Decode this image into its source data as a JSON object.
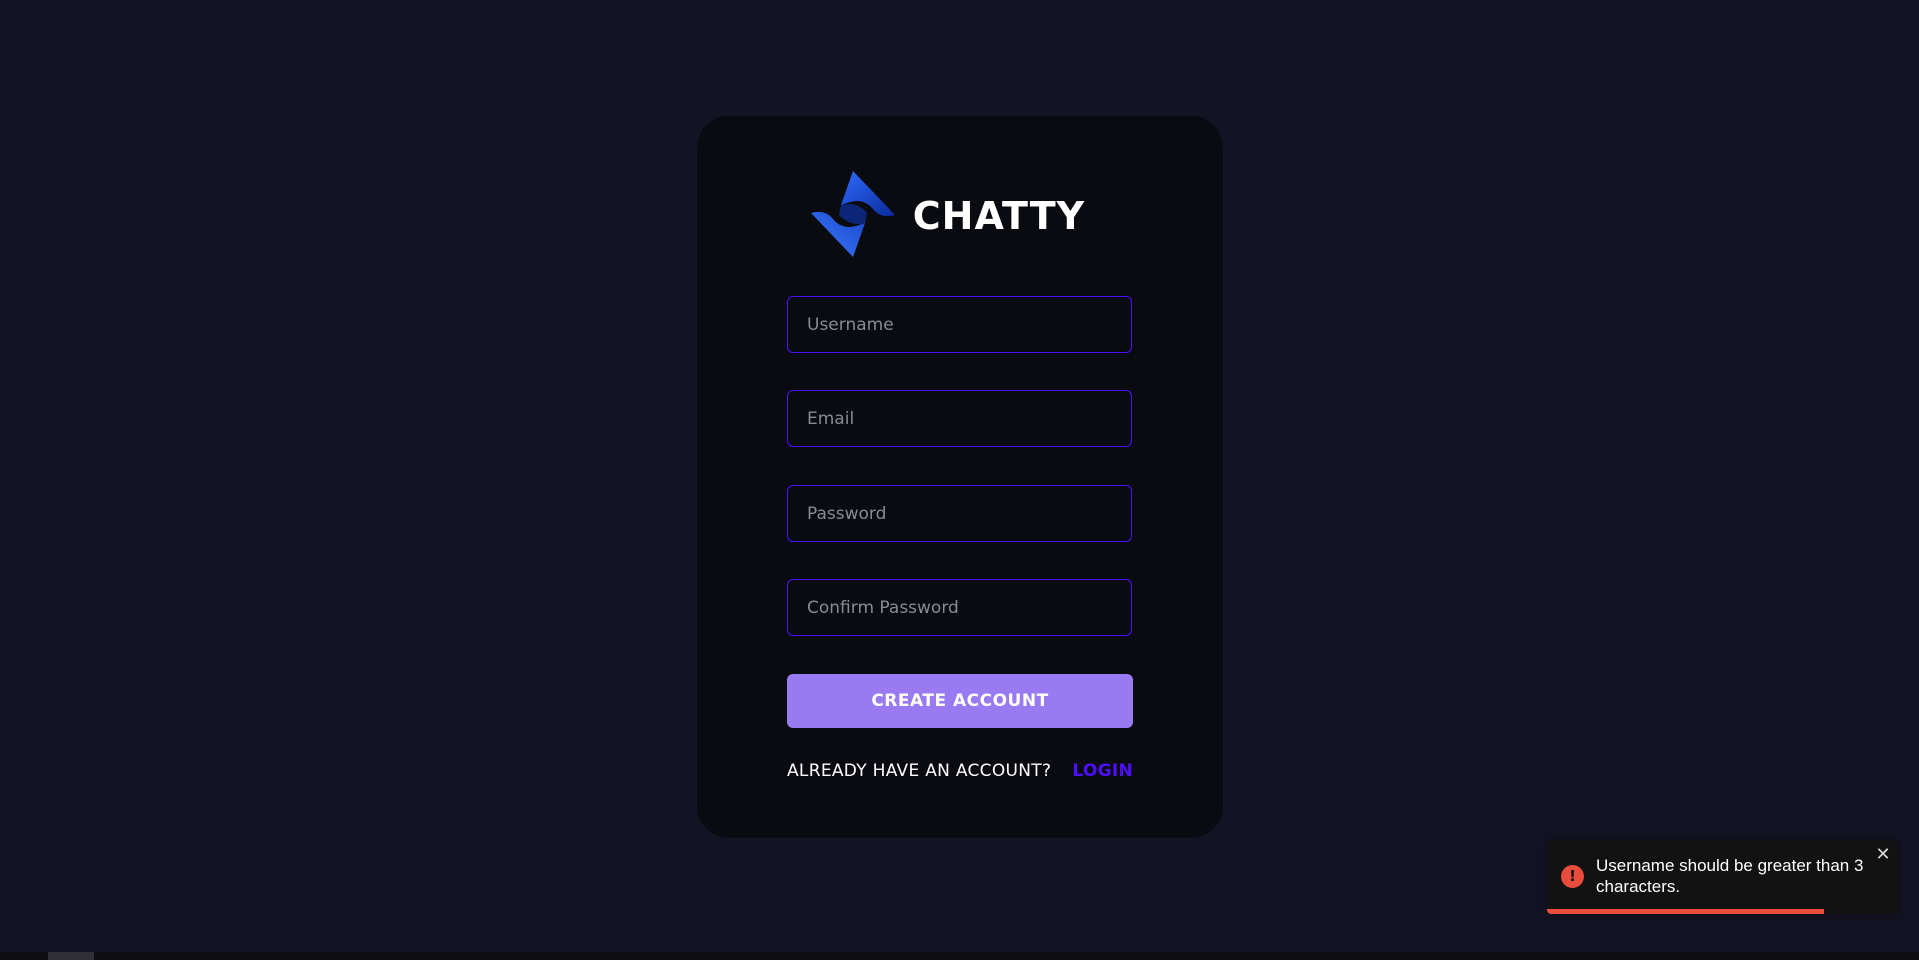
{
  "app": {
    "brand_name": "CHATTY",
    "logo_icon": "chatty-logo-icon"
  },
  "form": {
    "username_placeholder": "Username",
    "email_placeholder": "Email",
    "password_placeholder": "Password",
    "confirm_password_placeholder": "Confirm Password",
    "username_value": "",
    "email_value": "",
    "password_value": "",
    "confirm_password_value": "",
    "submit_label": "CREATE ACCOUNT",
    "login_prompt": "ALREADY HAVE AN ACCOUNT?",
    "login_link": "LOGIN"
  },
  "toast": {
    "message": "Username should be greater than 3 characters.",
    "icon": "error-icon",
    "close_icon": "close-icon",
    "progress": 0.79
  },
  "colors": {
    "background": "#131324",
    "card": "#0a0a11",
    "accent": "#4e0eff",
    "button": "#997af0",
    "error": "#e74c3c",
    "logo": "#1a4fd1"
  }
}
